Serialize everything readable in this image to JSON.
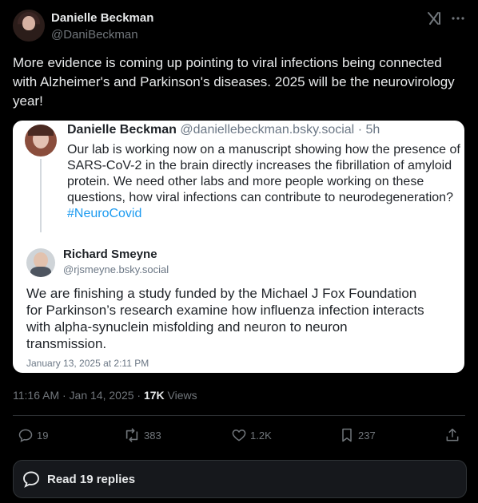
{
  "author": {
    "name": "Danielle Beckman",
    "handle": "@DaniBeckman"
  },
  "tweet": {
    "text": "More evidence is coming up pointing to viral infections being connected with Alzheimer's and Parkinson's diseases. 2025 will be the neurovirology year!"
  },
  "quoted": {
    "post1": {
      "name": "Danielle Beckman",
      "handle": "@daniellebeckman.bsky.social",
      "time": "· 5h",
      "text": "Our lab is working now on a manuscript showing how the presence of SARS-CoV-2 in the brain directly increases the fibrillation of amyloid protein. We need other labs and more people working on these questions, how viral infections can contribute to neurodegeneration?",
      "hashtag": "#NeuroCovid"
    },
    "post2": {
      "name": "Richard Smeyne",
      "handle": "@rjsmeyne.bsky.social",
      "text": "We are finishing a study funded by the Michael J Fox Foundation for Parkinson’s research examine how influenza infection interacts with alpha-synuclein misfolding and neuron to neuron transmission.",
      "date": "January 13, 2025 at 2:11 PM"
    }
  },
  "meta": {
    "time": "11:16 AM · Jan 14, 2025 · ",
    "views_count": "17K",
    "views_label": " Views"
  },
  "actions": {
    "replies": "19",
    "reposts": "383",
    "likes": "1.2K",
    "bookmarks": "237"
  },
  "read_replies": "Read 19 replies",
  "icons": {
    "grok": "grok-icon",
    "more": "more-icon",
    "reply": "reply-icon",
    "repost": "repost-icon",
    "like": "heart-icon",
    "bookmark": "bookmark-icon",
    "share": "share-icon",
    "speech": "speech-bubble-icon"
  }
}
